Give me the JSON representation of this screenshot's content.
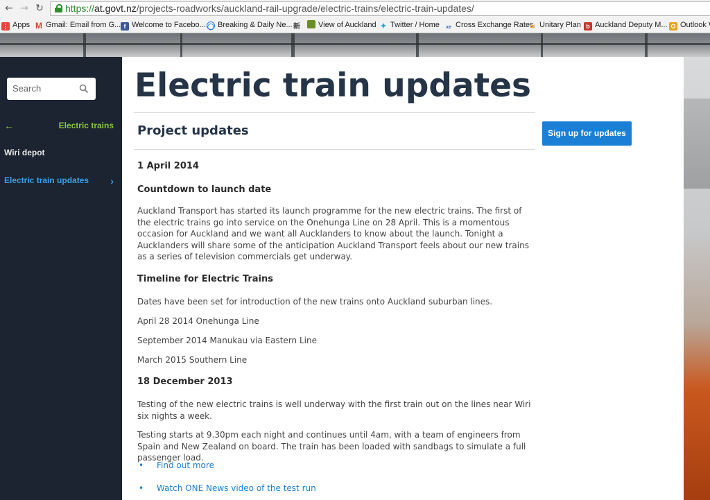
{
  "browser": {
    "url_scheme": "https://",
    "url_host": "at.govt.nz",
    "url_path": "/projects-roadworks/auckland-rail-upgrade/electric-trains/electric-train-updates/",
    "bookmarks": [
      {
        "label": "Apps",
        "icon": "apps-icon",
        "color": "#e8453c"
      },
      {
        "label": "Gmail: Email from G...",
        "icon": "gmail-icon",
        "color": "#d44638"
      },
      {
        "label": "Welcome to Facebo...",
        "icon": "facebook-icon",
        "color": "#3b5998"
      },
      {
        "label": "Breaking & Daily Ne...",
        "icon": "globe-icon",
        "color": "#1a73e8"
      },
      {
        "label": "",
        "icon": "chinese-icon",
        "color": "#444444"
      },
      {
        "label": "View of Auckland",
        "icon": "photo-icon",
        "color": "#6b8e23"
      },
      {
        "label": "Twitter / Home",
        "icon": "twitter-icon",
        "color": "#1da1f2"
      },
      {
        "label": "Cross Exchange Rates",
        "icon": "exchange-icon",
        "color": "#2b6cb0"
      },
      {
        "label": "Unitary Plan",
        "icon": "plan-icon",
        "color": "#e8a33c"
      },
      {
        "label": "Auckland Deputy M...",
        "icon": "bookmark-icon",
        "color": "#c0392b"
      },
      {
        "label": "Outlook W",
        "icon": "outlook-icon",
        "color": "#e8a31c"
      }
    ]
  },
  "sidebar": {
    "search_placeholder": "Search",
    "back_label": "Electric trains",
    "items": [
      {
        "label": "Wiri depot"
      },
      {
        "label": "Electric train updates"
      }
    ]
  },
  "main": {
    "title": "Electric train updates",
    "section_heading": "Project updates",
    "signup_label": "Sign up for updates",
    "date1": "1 April 2014",
    "heading1": "Countdown to launch date",
    "para1": "Auckland Transport has started its launch programme for the new electric trains. The first of the electric trains go into service on the Onehunga Line on 28 April. This is a momentous occasion for Auckland and we want all Aucklanders to know about the launch. Tonight a Aucklanders will share some of the anticipation Auckland Transport feels about our new trains as a series of television commercials get underway.",
    "heading2": "Timeline for Electric Trains",
    "para2": "Dates have been set for introduction of the new trains onto Auckland suburban lines.",
    "timeline": [
      "April 28 2014 Onehunga Line",
      "September 2014 Manukau via Eastern Line",
      "March 2015 Southern Line"
    ],
    "date2": "18 December 2013",
    "para3": "Testing of the new electric trains is well underway with the first train out on the lines near Wiri six nights a week.",
    "para4": "Testing starts at 9.30pm each night and continues until 4am, with a team of engineers from Spain and New Zealand on board. The train has been loaded with sandbags to simulate a full passenger load.",
    "links": [
      "Find out more",
      "Watch ONE News video of the test run"
    ]
  }
}
